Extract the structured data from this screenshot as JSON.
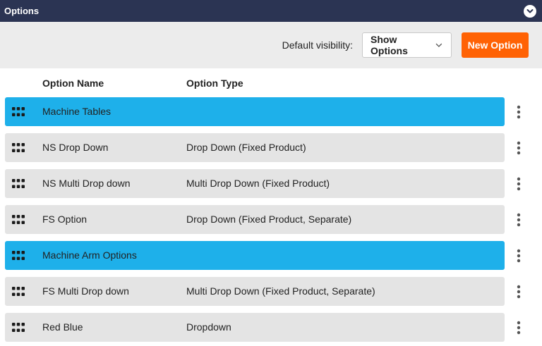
{
  "panel": {
    "title": "Options",
    "collapse_icon": "chevron-down-icon"
  },
  "toolbar": {
    "visibility_label": "Default visibility:",
    "visibility_value": "Show Options",
    "new_option_label": "New Option"
  },
  "columns": {
    "name": "Option Name",
    "type": "Option Type"
  },
  "rows": [
    {
      "name": "Machine Tables",
      "type": "",
      "kind": "group"
    },
    {
      "name": "NS Drop Down",
      "type": "Drop Down (Fixed Product)",
      "kind": "option"
    },
    {
      "name": "NS Multi Drop down",
      "type": "Multi Drop Down (Fixed Product)",
      "kind": "option"
    },
    {
      "name": "FS Option",
      "type": "Drop Down (Fixed Product, Separate)",
      "kind": "option"
    },
    {
      "name": "Machine Arm Options",
      "type": "",
      "kind": "group"
    },
    {
      "name": "FS Multi Drop down",
      "type": "Multi Drop Down (Fixed Product, Separate)",
      "kind": "option"
    },
    {
      "name": "Red Blue",
      "type": "Dropdown",
      "kind": "option"
    }
  ],
  "colors": {
    "header_bg": "#2b3453",
    "toolbar_bg": "#ececec",
    "accent_button": "#ff6204",
    "group_row": "#1eb0ea",
    "option_row": "#e4e4e4"
  },
  "icons": {
    "drag_handle": "grip-icon",
    "row_menu": "more-vertical-icon",
    "select_caret": "chevron-down-icon"
  }
}
